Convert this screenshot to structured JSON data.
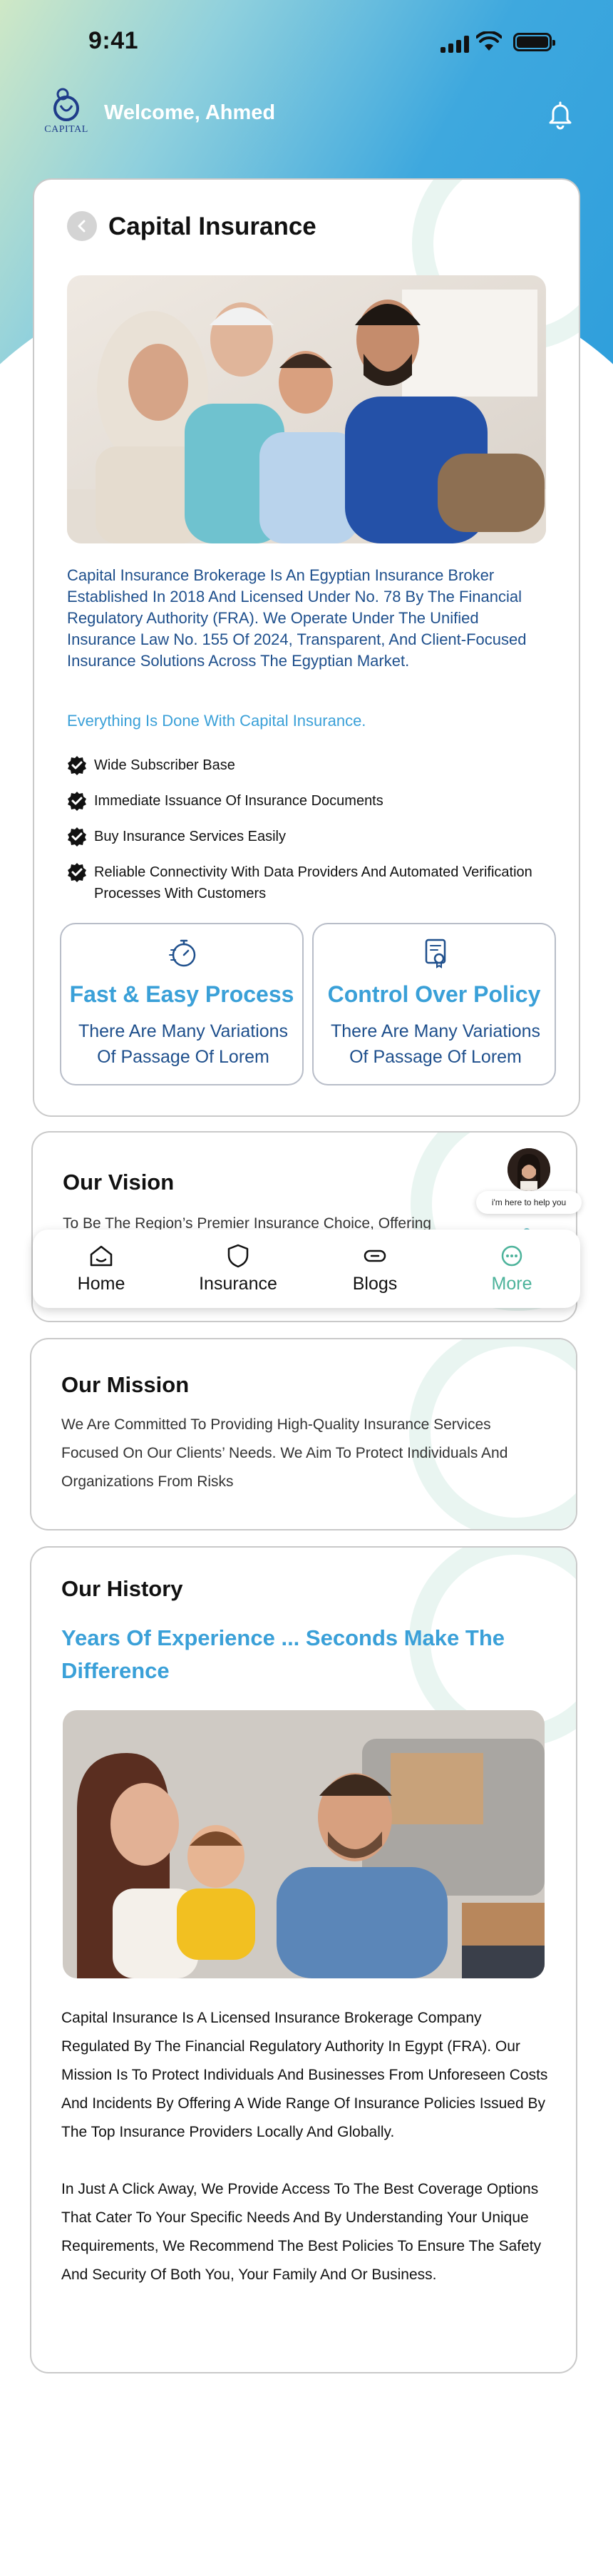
{
  "status_bar": {
    "time": "9:41"
  },
  "header": {
    "logo_text": "CAPITAL",
    "welcome": "Welcome, Ahmed"
  },
  "capital": {
    "title": "Capital Insurance",
    "intro": "Capital Insurance Brokerage Is An Egyptian Insurance Broker Established In 2018 And Licensed Under No. 78 By The Financial Regulatory Authority (FRA). We Operate Under The Unified Insurance Law No. 155 Of 2024, Transparent, And Client-Focused Insurance Solutions Across The Egyptian Market.",
    "tagline": "Everything Is Done With Capital Insurance.",
    "features": [
      "Wide Subscriber Base",
      "Immediate Issuance Of Insurance Documents",
      "Buy Insurance Services Easily",
      "Reliable Connectivity With Data Providers And Automated Verification Processes With Customers"
    ],
    "boxes": [
      {
        "title": "Fast & Easy Process",
        "desc": "There Are Many Variations Of Passage Of Lorem"
      },
      {
        "title": "Control Over Policy",
        "desc": "There Are Many Variations Of Passage Of Lorem"
      }
    ]
  },
  "vision": {
    "title": "Our Vision",
    "text": "To Be The Region’s Premier Insurance Choice, Offering"
  },
  "helper": {
    "bubble": "i'm here to help you"
  },
  "nav": {
    "items": [
      {
        "label": "Home",
        "icon": "home-icon"
      },
      {
        "label": "Insurance",
        "icon": "shield-icon"
      },
      {
        "label": "Blogs",
        "icon": "link-icon"
      },
      {
        "label": "More",
        "icon": "more-icon"
      }
    ],
    "active": "More"
  },
  "mission": {
    "title": "Our Mission",
    "text": "We Are Committed To Providing High-Quality Insurance Services Focused On Our Clients’ Needs. We Aim To Protect Individuals And Organizations From Risks"
  },
  "history": {
    "title": "Our History",
    "subtitle": "Years Of Experience ... Seconds Make The Difference",
    "para1": "Capital Insurance Is A Licensed Insurance Brokerage Company Regulated By The Financial Regulatory Authority In Egypt (FRA). Our Mission Is To Protect Individuals And Businesses From Unforeseen Costs And Incidents By Offering A Wide Range Of Insurance Policies Issued By The Top Insurance Providers Locally And Globally.",
    "para2": "In Just A Click Away, We Provide Access To The Best Coverage Options That Cater To Your Specific Needs And By Understanding Your Unique Requirements, We Recommend The Best Policies To Ensure The Safety And Security Of Both You, Your Family And Or Business."
  },
  "colors": {
    "accent": "#3aa0d8",
    "body_blue": "#1e4f8c",
    "active_nav": "#4db39b"
  }
}
